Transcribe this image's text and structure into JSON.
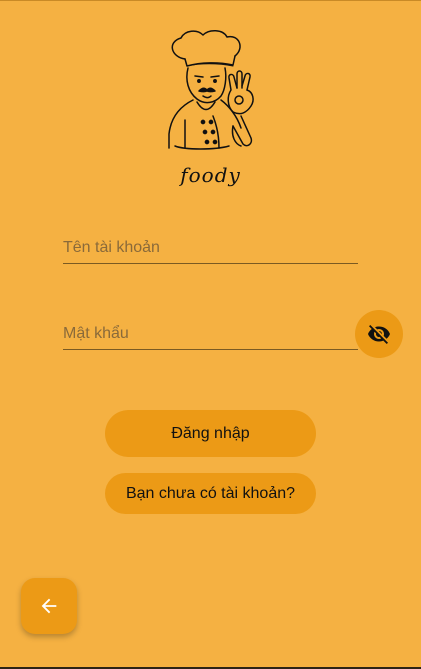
{
  "app": {
    "brand": "foody"
  },
  "login_form": {
    "username_placeholder": "Tên tài khoản",
    "password_placeholder": "Mật khẩu",
    "username_value": "",
    "password_value": ""
  },
  "actions": {
    "login_label": "Đăng nhập",
    "register_label": "Bạn chưa có tài khoản?"
  },
  "icons": {
    "visibility_toggle": "visibility-off-icon",
    "back": "arrow-left-icon",
    "logo": "chef-logo-icon"
  },
  "colors": {
    "background": "#f5b142",
    "accent": "#ec9a16"
  }
}
